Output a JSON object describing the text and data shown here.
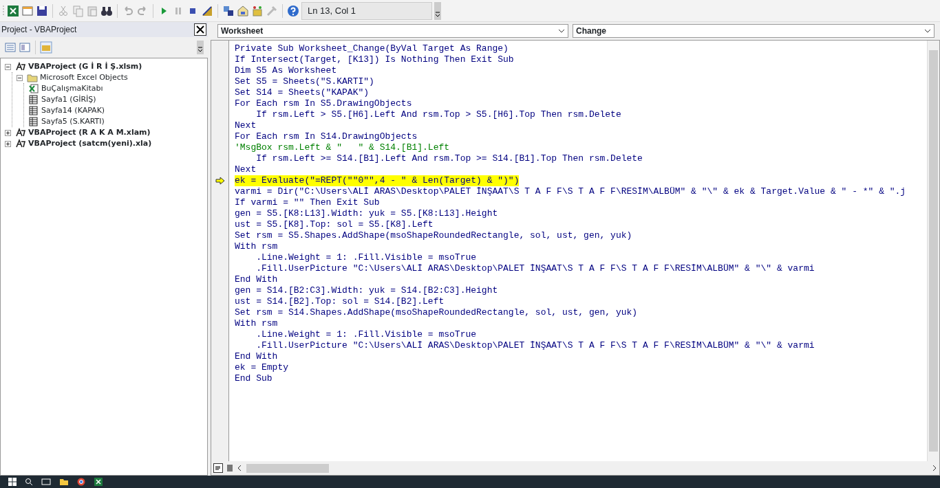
{
  "toolbar": {
    "position": "Ln 13, Col 1"
  },
  "project_panel": {
    "title": "Project - VBAProject",
    "tree": [
      {
        "label": "VBAProject (G İ R İ Ş.xlsm)",
        "kind": "project",
        "expanded": true,
        "children": [
          {
            "label": "Microsoft Excel Objects",
            "kind": "folder",
            "expanded": true,
            "children": [
              {
                "label": "BuÇalışmaKitabı",
                "kind": "workbook"
              },
              {
                "label": "Sayfa1 (GİRİŞ)",
                "kind": "sheet"
              },
              {
                "label": "Sayfa14 (KAPAK)",
                "kind": "sheet"
              },
              {
                "label": "Sayfa5 (S.KARTI)",
                "kind": "sheet"
              }
            ]
          }
        ]
      },
      {
        "label": "VBAProject (R A K A M.xlam)",
        "kind": "project",
        "expanded": false
      },
      {
        "label": "VBAProject (satcm(yeni).xla)",
        "kind": "project",
        "expanded": false
      }
    ]
  },
  "code_window": {
    "object_dropdown": "Worksheet",
    "procedure_dropdown": "Change",
    "lines": [
      {
        "text": "Private Sub Worksheet_Change(ByVal Target As Range)",
        "kind": "code"
      },
      {
        "text": "If Intersect(Target, [K13]) Is Nothing Then Exit Sub",
        "kind": "code"
      },
      {
        "text": "Dim S5 As Worksheet",
        "kind": "code"
      },
      {
        "text": "Set S5 = Sheets(\"S.KARTI\")",
        "kind": "code"
      },
      {
        "text": "Set S14 = Sheets(\"KAPAK\")",
        "kind": "code"
      },
      {
        "text": "For Each rsm In S5.DrawingObjects",
        "kind": "code"
      },
      {
        "text": "    If rsm.Left > S5.[H6].Left And rsm.Top > S5.[H6].Top Then rsm.Delete",
        "kind": "code"
      },
      {
        "text": "Next",
        "kind": "code"
      },
      {
        "text": "For Each rsm In S14.DrawingObjects",
        "kind": "code"
      },
      {
        "text": "'MsgBox rsm.Left & \"   \" & S14.[B1].Left",
        "kind": "comment"
      },
      {
        "text": "    If rsm.Left >= S14.[B1].Left And rsm.Top >= S14.[B1].Top Then rsm.Delete",
        "kind": "code"
      },
      {
        "text": "Next",
        "kind": "code"
      },
      {
        "text": "ek = Evaluate(\"=REPT(\"\"0\"\",4 - \" & Len(Target) & \")\")",
        "kind": "current"
      },
      {
        "text": "varmi = Dir(\"C:\\Users\\ALİ ARAS\\Desktop\\PALET İNŞAAT\\S T A F F\\S T A F F\\RESİM\\ALBÜM\" & \"\\\" & ek & Target.Value & \" - *\" & \".j",
        "kind": "code"
      },
      {
        "text": "If varmi = \"\" Then Exit Sub",
        "kind": "code"
      },
      {
        "text": "gen = S5.[K8:L13].Width: yuk = S5.[K8:L13].Height",
        "kind": "code"
      },
      {
        "text": "ust = S5.[K8].Top: sol = S5.[K8].Left",
        "kind": "code"
      },
      {
        "text": "Set rsm = S5.Shapes.AddShape(msoShapeRoundedRectangle, sol, ust, gen, yuk)",
        "kind": "code"
      },
      {
        "text": "With rsm",
        "kind": "code"
      },
      {
        "text": "    .Line.Weight = 1: .Fill.Visible = msoTrue",
        "kind": "code"
      },
      {
        "text": "    .Fill.UserPicture \"C:\\Users\\ALİ ARAS\\Desktop\\PALET İNŞAAT\\S T A F F\\S T A F F\\RESİM\\ALBÜM\" & \"\\\" & varmi",
        "kind": "code"
      },
      {
        "text": "End With",
        "kind": "code"
      },
      {
        "text": "gen = S14.[B2:C3].Width: yuk = S14.[B2:C3].Height",
        "kind": "code"
      },
      {
        "text": "ust = S14.[B2].Top: sol = S14.[B2].Left",
        "kind": "code"
      },
      {
        "text": "Set rsm = S14.Shapes.AddShape(msoShapeRoundedRectangle, sol, ust, gen, yuk)",
        "kind": "code"
      },
      {
        "text": "With rsm",
        "kind": "code"
      },
      {
        "text": "    .Line.Weight = 1: .Fill.Visible = msoTrue",
        "kind": "code"
      },
      {
        "text": "    .Fill.UserPicture \"C:\\Users\\ALİ ARAS\\Desktop\\PALET İNŞAAT\\S T A F F\\S T A F F\\RESİM\\ALBÜM\" & \"\\\" & varmi",
        "kind": "code"
      },
      {
        "text": "End With",
        "kind": "code"
      },
      {
        "text": "ek = Empty",
        "kind": "code"
      },
      {
        "text": "End Sub",
        "kind": "code"
      }
    ]
  }
}
